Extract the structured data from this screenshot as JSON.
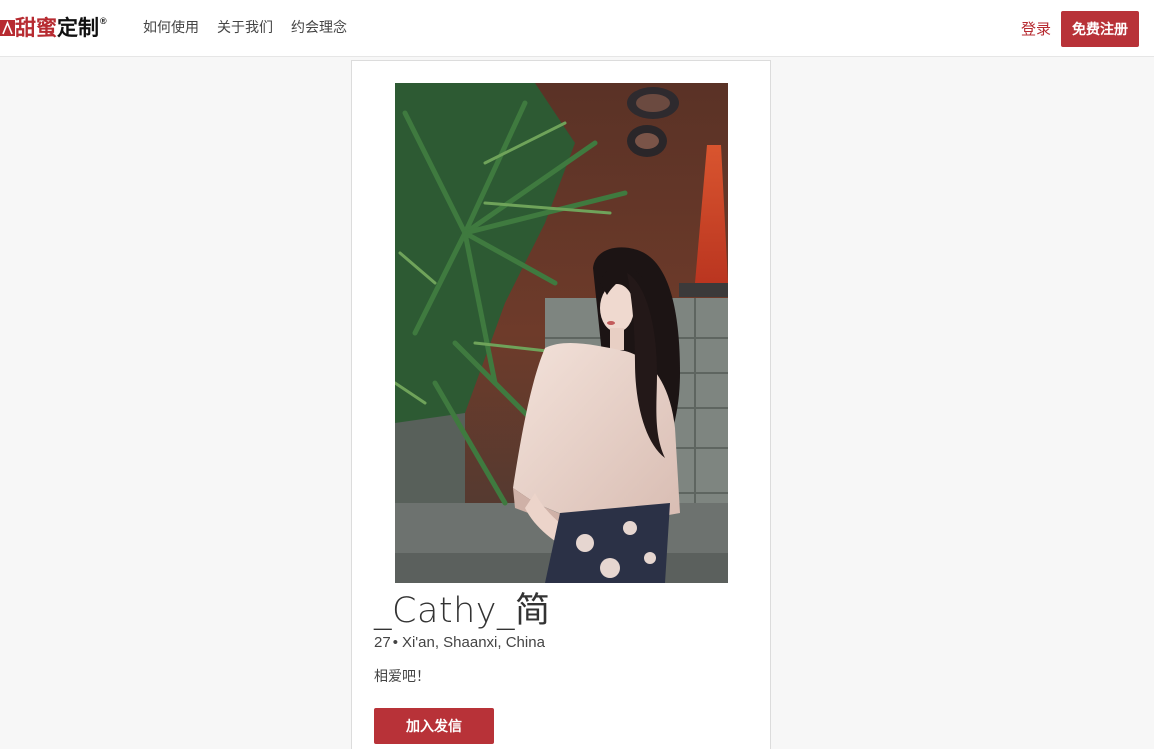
{
  "header": {
    "logo_red": "甜蜜",
    "logo_dark": "定制",
    "logo_reg": "®",
    "nav": [
      "如何使用",
      "关于我们",
      "约会理念"
    ],
    "login": "登录",
    "register": "免费注册"
  },
  "profile": {
    "name": "_Cathy_简",
    "age": "27",
    "separator": "•",
    "location": "Xi'an, Shaanxi, China",
    "bio": "相爱吧！",
    "action": "加入发信"
  },
  "colors": {
    "brand": "#b83238",
    "background": "#f7f7f7"
  }
}
